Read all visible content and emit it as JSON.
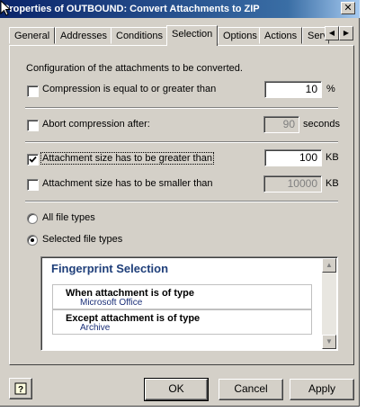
{
  "window": {
    "title": "Properties of OUTBOUND: Convert Attachments to ZIP",
    "close_glyph": "✕"
  },
  "tabs": [
    "General",
    "Addresses",
    "Conditions",
    "Selection",
    "Options",
    "Actions",
    "Serv"
  ],
  "selected_tab": "Selection",
  "tab_scroll": {
    "left": "◀",
    "right": "▶"
  },
  "panel": {
    "heading": "Configuration of the attachments to be converted.",
    "compression": {
      "label": "Compression is equal to or greater than",
      "checked": false,
      "value": "10",
      "unit": "%"
    },
    "abort": {
      "label": "Abort compression after:",
      "checked": false,
      "value": "90",
      "unit": "seconds",
      "enabled": false
    },
    "size_greater": {
      "label": "Attachment size has to be greater than",
      "checked": true,
      "value": "100",
      "unit": "KB"
    },
    "size_smaller": {
      "label": "Attachment size has to be smaller than",
      "checked": false,
      "value": "10000",
      "unit": "KB",
      "enabled": false
    },
    "file_types": {
      "all_label": "All file types",
      "selected_label": "Selected file types",
      "selected": "selected"
    },
    "fingerprint": {
      "title": "Fingerprint Selection",
      "items": [
        {
          "heading": "When attachment is of type",
          "value": "Microsoft Office"
        },
        {
          "heading": "Except attachment is of type",
          "value": "Archive"
        }
      ]
    }
  },
  "buttons": {
    "ok": "OK",
    "cancel": "Cancel",
    "apply": "Apply"
  },
  "icons": {
    "help": "help-icon",
    "checkmark": "checkmark-icon",
    "cursor": "mouse-pointer-icon"
  },
  "colors": {
    "title_bar": "#0a246a",
    "window_bg": "#d4d0c8",
    "fingerprint_title": "#1f3f7a"
  }
}
